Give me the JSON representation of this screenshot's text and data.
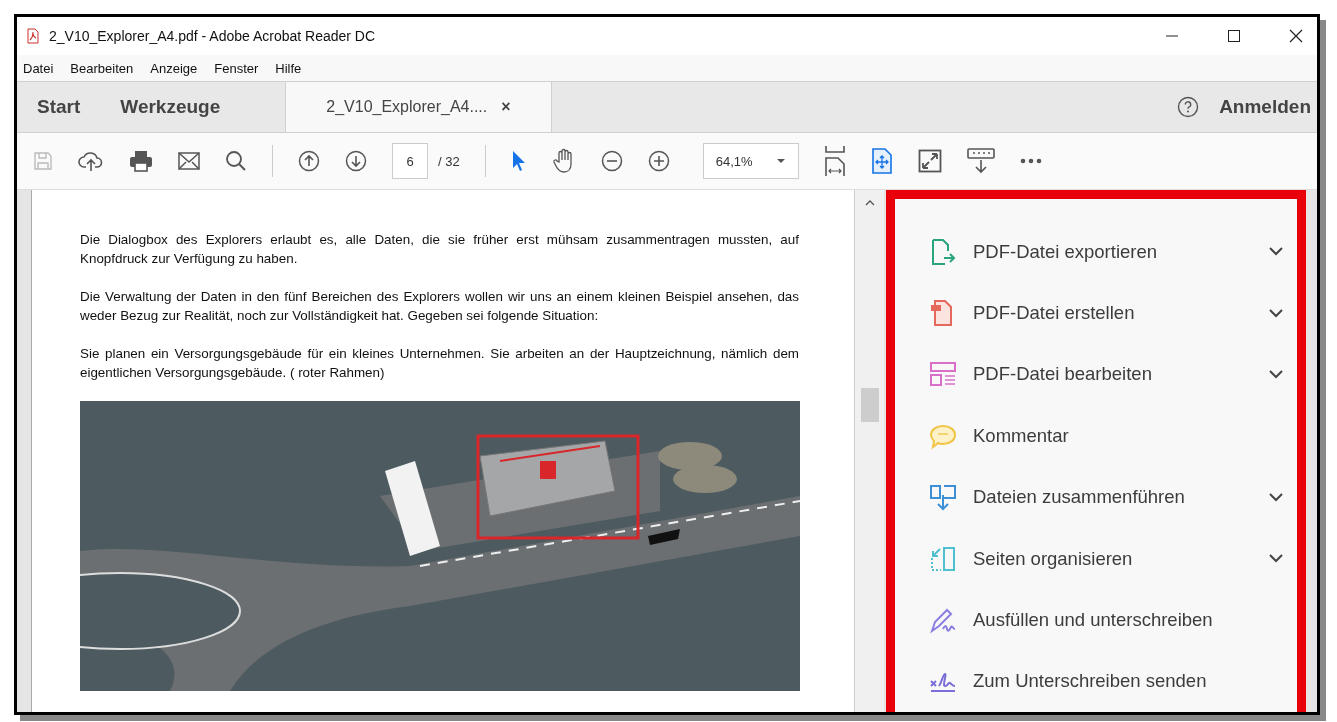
{
  "window": {
    "title": "2_V10_Explorer_A4.pdf - Adobe Acrobat Reader DC"
  },
  "menu": [
    "Datei",
    "Bearbeiten",
    "Anzeige",
    "Fenster",
    "Hilfe"
  ],
  "tabs": [
    {
      "label": "Start",
      "selected": false,
      "closable": false
    },
    {
      "label": "Werkzeuge",
      "selected": false,
      "closable": false
    },
    {
      "label": "2_V10_Explorer_A4....",
      "selected": true,
      "closable": true,
      "close": "×"
    }
  ],
  "account": {
    "sign_in": "Anmelden"
  },
  "toolbar": {
    "page": "6",
    "page_total": "/ 32",
    "zoom": "64,1%",
    "save_disabled": true
  },
  "document": {
    "paragraphs": [
      "Die Dialogbox des Explorers erlaubt es, alle Daten, die sie früher erst mühsam zusammentragen mussten, auf Knopfdruck zur Verfügung zu haben.",
      "Die Verwaltung der Daten in den fünf Bereichen des Explorers wollen wir uns an einem kleinen Beispiel ansehen, das weder Bezug zur Realität, noch zur Vollständigkeit hat. Gegeben sei folgende Situation:",
      "Sie planen ein Versorgungsgebäude für ein kleines Unternehmen. Sie arbeiten an der Hauptzeichnung, nämlich dem eigentlichen Versorgungsgebäude. ( roter Rahmen)"
    ]
  },
  "tools": [
    {
      "label": "PDF-Datei exportieren",
      "kind": "export",
      "color": "#2aa37f",
      "expandable": true
    },
    {
      "label": "PDF-Datei erstellen",
      "kind": "create",
      "color": "#e4685c",
      "expandable": true
    },
    {
      "label": "PDF-Datei bearbeiten",
      "kind": "edit",
      "color": "#d96fc9",
      "expandable": true
    },
    {
      "label": "Kommentar",
      "kind": "comment",
      "color": "#f0c445",
      "expandable": false
    },
    {
      "label": "Dateien zusammenführen",
      "kind": "combine",
      "color": "#3d8fd6",
      "expandable": true
    },
    {
      "label": "Seiten organisieren",
      "kind": "organize",
      "color": "#4fc0cf",
      "expandable": true
    },
    {
      "label": "Ausfüllen und unterschreiben",
      "kind": "fill-sign",
      "color": "#8a7fe0",
      "expandable": false
    },
    {
      "label": "Zum Unterschreiben senden",
      "kind": "send-sign",
      "color": "#7a6fd6",
      "expandable": false
    }
  ]
}
